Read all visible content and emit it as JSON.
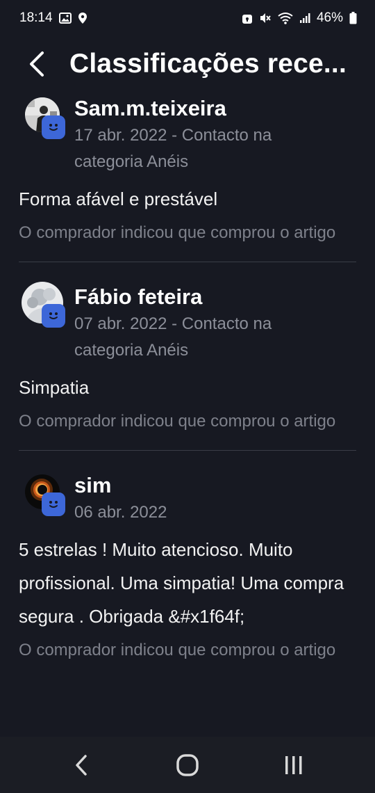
{
  "status_bar": {
    "time": "18:14",
    "battery": "46%",
    "icons_left": [
      "gallery-icon",
      "location-icon"
    ],
    "icons_right": [
      "lock-icon",
      "mute-icon",
      "wifi-icon",
      "signal-icon",
      "battery-icon"
    ]
  },
  "header": {
    "title": "Classificações rece...",
    "back_icon": "back-arrow-icon"
  },
  "reviews": [
    {
      "name": "Sam.m.teixeira",
      "meta": "17 abr. 2022 - Contacto na categoria Anéis",
      "text": "Forma afável e prestável",
      "note": "O comprador indicou que comprou o artigo"
    },
    {
      "name": "Fábio feteira",
      "meta": "07 abr. 2022 - Contacto na categoria Anéis",
      "text": "Simpatia",
      "note": "O comprador indicou que comprou o artigo"
    },
    {
      "name": "sim",
      "meta": "06 abr. 2022",
      "text": "5 estrelas ! Muito atencioso. Muito profissional. Uma simpatia! Uma compra segura . Obrigada &#x1f64f;",
      "note": "O comprador indicou que comprou o artigo"
    }
  ],
  "nav_bar": {
    "icons": [
      "back-icon",
      "home-icon",
      "recents-icon"
    ]
  },
  "colors": {
    "background": "#171922",
    "badge": "#3d67d8",
    "muted_text": "#8c8f99"
  }
}
